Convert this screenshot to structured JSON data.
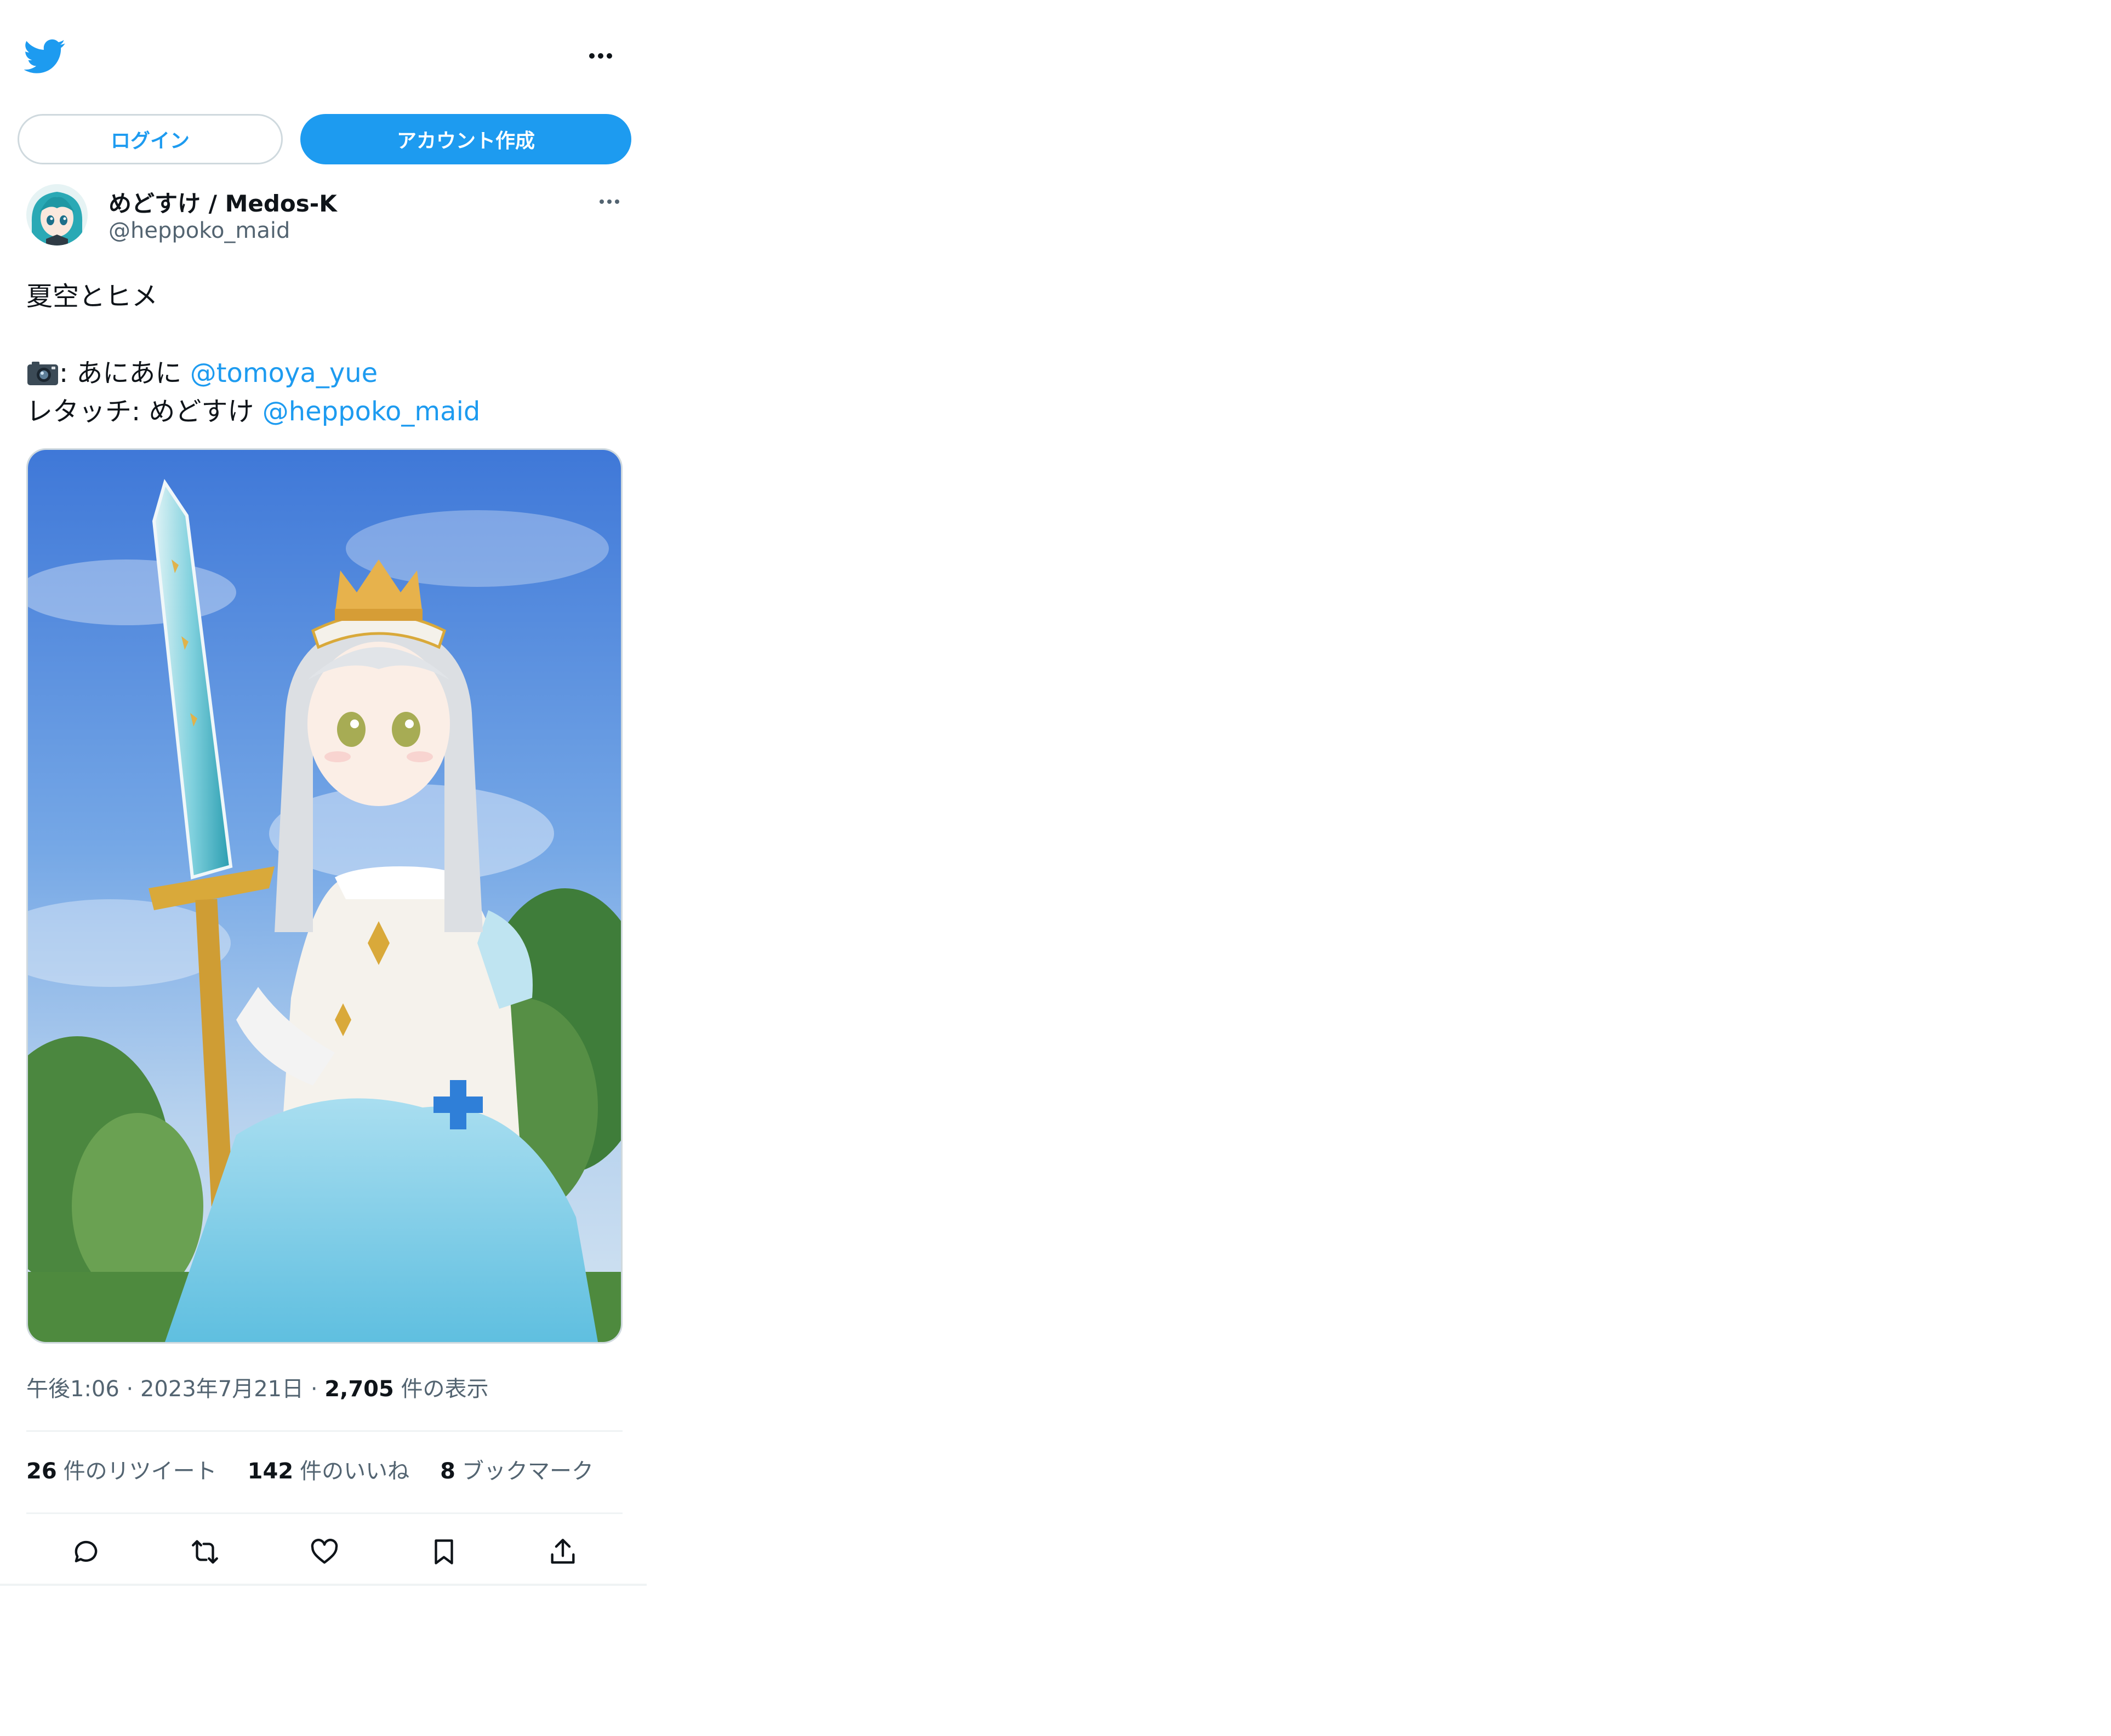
{
  "header": {
    "logo_icon": "twitter-bird-icon",
    "more_icon": "more-horizontal-icon",
    "brand_color": "#1d9bf0"
  },
  "buttons": {
    "login_label": "ログイン",
    "signup_label": "アカウント作成"
  },
  "tweet": {
    "author": {
      "display_name": "めどすけ / Medos-K",
      "handle": "@heppoko_maid"
    },
    "text": {
      "line1": "夏空とヒメ",
      "camera_suffix": ": あにあに ",
      "camera_mention": "@tomoya_yue",
      "retouch_prefix": "レタッチ: めどすけ ",
      "retouch_mention": "@heppoko_maid"
    },
    "meta": {
      "time": "午後1:06",
      "separator": " · ",
      "date": "2023年7月21日",
      "views_count": "2,705",
      "views_label": " 件の表示"
    },
    "stats": {
      "retweets_count": "26",
      "retweets_label": "件のリツイート",
      "likes_count": "142",
      "likes_label": "件のいいね",
      "bookmarks_count": "8",
      "bookmarks_label": "ブックマーク"
    },
    "actions": [
      "reply-icon",
      "retweet-icon",
      "like-icon",
      "bookmark-icon",
      "share-icon"
    ]
  }
}
